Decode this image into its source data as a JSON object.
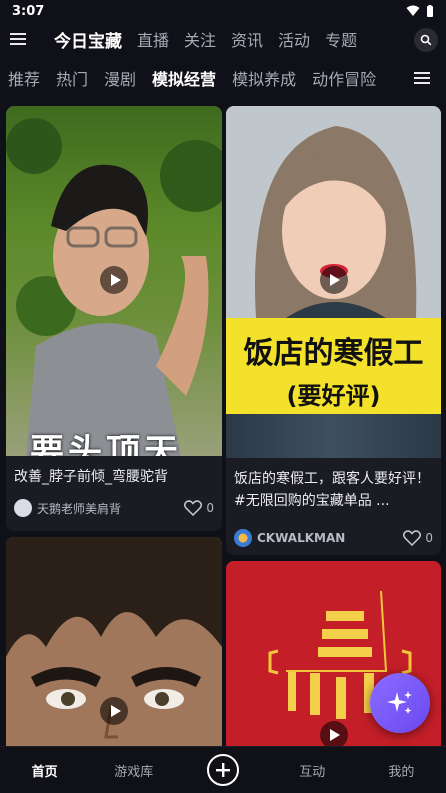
{
  "status_bar": {
    "time": "3:07"
  },
  "top_nav": {
    "tabs": [
      {
        "label": "今日宝藏",
        "active": true
      },
      {
        "label": "直播",
        "active": false
      },
      {
        "label": "关注",
        "active": false
      },
      {
        "label": "资讯",
        "active": false
      },
      {
        "label": "活动",
        "active": false
      },
      {
        "label": "专题",
        "active": false
      }
    ]
  },
  "category_tabs": [
    {
      "label": "推荐",
      "active": false
    },
    {
      "label": "热门",
      "active": false
    },
    {
      "label": "漫剧",
      "active": false
    },
    {
      "label": "模拟经营",
      "active": true
    },
    {
      "label": "模拟养成",
      "active": false
    },
    {
      "label": "动作冒险",
      "active": false
    }
  ],
  "feed": {
    "cards": [
      {
        "thumb_text": "要头顶天",
        "caption": "改善_脖子前倾_弯腰驼背",
        "author": "天鹅老师美肩背",
        "likes": "0"
      },
      {
        "thumb_text": "饭店的寒假工",
        "thumb_subtext": "(要好评)",
        "caption": "饭店的寒假工，跟客人要好评！#无限回购的宝藏单品 ...",
        "author": "CKWALKMAN",
        "likes": "0"
      },
      {
        "caption": "",
        "author": "",
        "likes": ""
      },
      {
        "thumb_text": "",
        "caption": "",
        "author": "",
        "likes": ""
      }
    ]
  },
  "bottom_nav": {
    "items": [
      {
        "label": "首页",
        "active": true
      },
      {
        "label": "游戏库",
        "active": false
      },
      {
        "label": "互动",
        "active": false
      },
      {
        "label": "我的",
        "active": false
      }
    ]
  },
  "colors": {
    "background": "#101019",
    "card": "#1b1b24",
    "accent": "#7b5cff",
    "yellow_banner": "#f3e12c"
  }
}
